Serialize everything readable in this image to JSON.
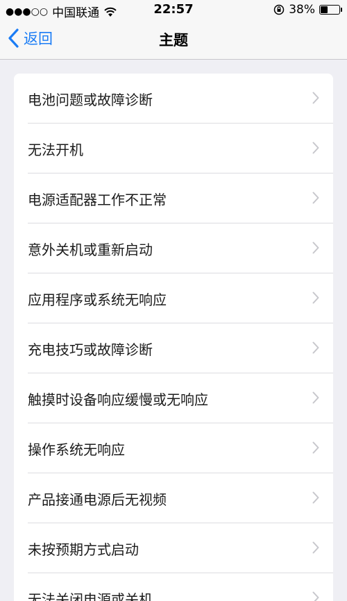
{
  "status_bar": {
    "signal": "●●●○○",
    "carrier": "中国联通",
    "time": "22:57",
    "battery": "38%",
    "battery_level": 0.38,
    "icons": [
      "wifi-icon",
      "rotation-lock-icon",
      "battery-icon"
    ]
  },
  "nav": {
    "back_label": "返回",
    "title": "主题"
  },
  "topics": [
    {
      "label": "电池问题或故障诊断"
    },
    {
      "label": "无法开机"
    },
    {
      "label": "电源适配器工作不正常"
    },
    {
      "label": "意外关机或重新启动"
    },
    {
      "label": "应用程序或系统无响应"
    },
    {
      "label": "充电技巧或故障诊断"
    },
    {
      "label": "触摸时设备响应缓慢或无响应"
    },
    {
      "label": "操作系统无响应"
    },
    {
      "label": "产品接通电源后无视频"
    },
    {
      "label": "未按预期方式启动"
    },
    {
      "label": "无法关闭电源或关机"
    }
  ],
  "colors": {
    "accent": "#1a7cf5",
    "background": "#efeff4",
    "card": "#ffffff",
    "chevron": "#c7c7cc"
  }
}
